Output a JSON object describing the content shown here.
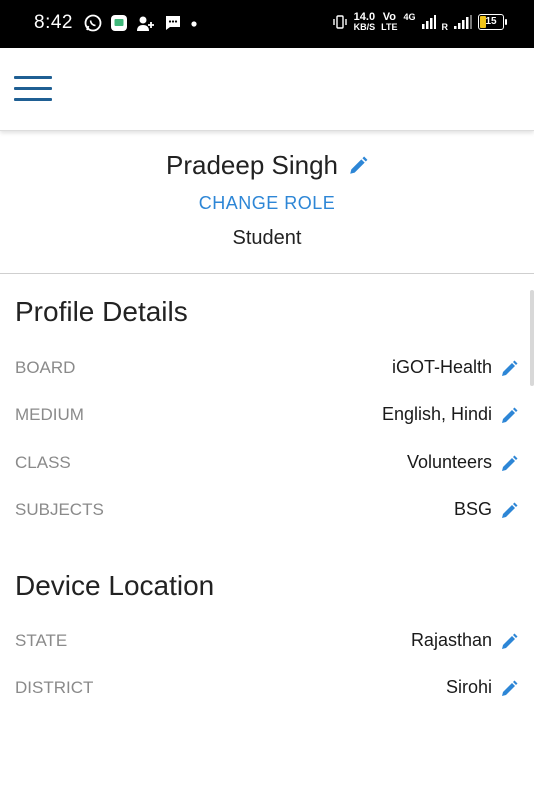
{
  "status_bar": {
    "time": "8:42",
    "speed_value": "14.0",
    "speed_unit": "KB/S",
    "volte_top": "Vo",
    "volte_bottom": "LTE",
    "network": "4G",
    "roaming": "R",
    "battery": "15",
    "left_icons": [
      "whatsapp-icon",
      "chat-app-icon",
      "add-person-icon",
      "message-icon",
      "dot-icon"
    ],
    "right_icons": [
      "vibrate-icon",
      "signal-icon",
      "signal-icon-2",
      "battery-icon"
    ]
  },
  "app_bar": {
    "menu_icon": "hamburger-menu-icon"
  },
  "profile": {
    "name": "Pradeep Singh",
    "change_role": "CHANGE ROLE",
    "role": "Student"
  },
  "profile_details": {
    "title": "Profile Details",
    "rows": [
      {
        "label": "BOARD",
        "value": "iGOT-Health"
      },
      {
        "label": "MEDIUM",
        "value": "English, Hindi"
      },
      {
        "label": "CLASS",
        "value": "Volunteers"
      },
      {
        "label": "SUBJECTS",
        "value": "BSG"
      }
    ]
  },
  "device_location": {
    "title": "Device Location",
    "rows": [
      {
        "label": "STATE",
        "value": "Rajasthan"
      },
      {
        "label": "DISTRICT",
        "value": "Sirohi"
      }
    ]
  },
  "colors": {
    "accent": "#2d86d6",
    "menu": "#1f5f93",
    "label": "#8a8a8a",
    "status_bar": "#000000"
  }
}
